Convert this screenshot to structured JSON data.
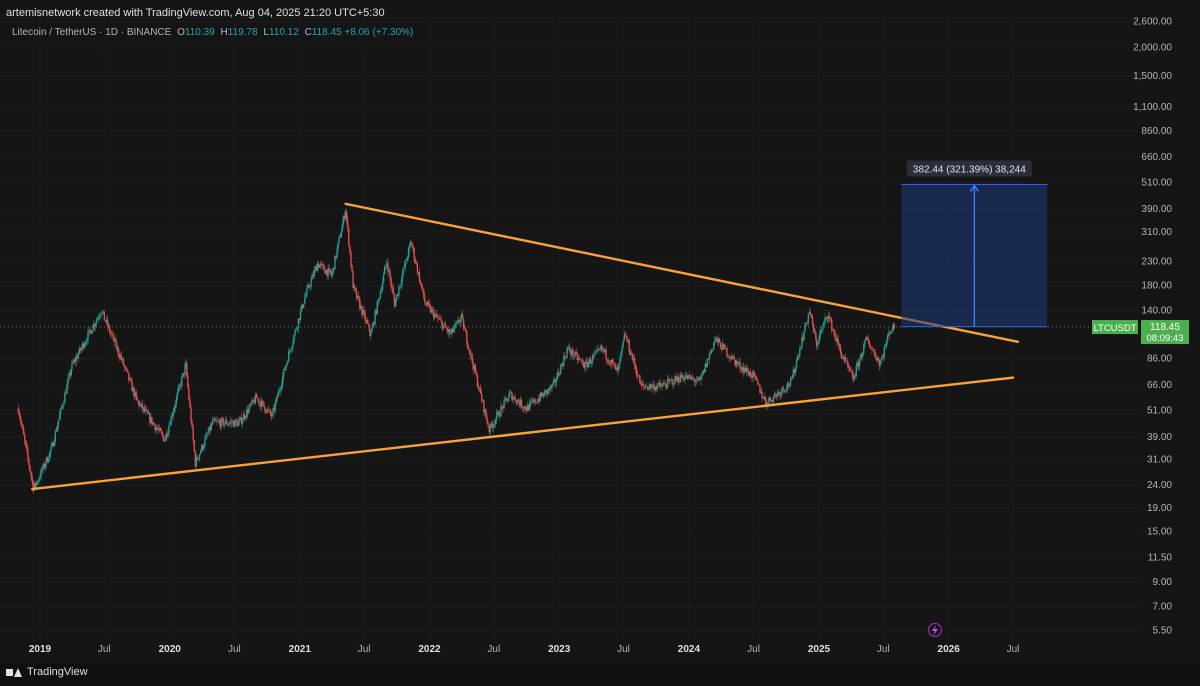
{
  "header": {
    "created_by": "artemisnetwork created with TradingView.com, Aug 04, 2025 21:20 UTC+5:30"
  },
  "symbol": {
    "name": "Litecoin / TetherUS · 1D · BINANCE",
    "o_label": "O",
    "o_value": "110.39",
    "h_label": "H",
    "h_value": "119.78",
    "l_label": "L",
    "l_value": "110.12",
    "c_label": "C",
    "c_value": "118.45",
    "change": "+8.06 (+7.30%)"
  },
  "brand": {
    "name": "TradingView"
  },
  "colors": {
    "background": "#131313",
    "trendline": "#f7a33a",
    "up": "#26a69a",
    "down": "#ef5350",
    "projection": "#2962ff",
    "price_tag": "#4caf50"
  },
  "chart_data": {
    "type": "candlestick",
    "y_scale": "log",
    "y_ticks": [
      "2,600.00",
      "2,000.00",
      "1,500.00",
      "1,100.00",
      "860.00",
      "660.00",
      "510.00",
      "390.00",
      "310.00",
      "230.00",
      "180.00",
      "140.00",
      "86.00",
      "66.00",
      "51.00",
      "39.00",
      "31.00",
      "24.00",
      "19.00",
      "15.00",
      "11.50",
      "9.00",
      "7.00",
      "5.50"
    ],
    "x_ticks": [
      "2019",
      "Jul",
      "2020",
      "Jul",
      "2021",
      "Jul",
      "2022",
      "Jul",
      "2023",
      "Jul",
      "2024",
      "Jul",
      "2025",
      "Jul",
      "2026",
      "Jul"
    ],
    "x_range": [
      "2019-01-01",
      "2026-09-15"
    ],
    "y_range": [
      5.2,
      2700
    ],
    "price_series": [
      [
        "2018-11-01",
        52
      ],
      [
        "2018-12-14",
        23
      ],
      [
        "2019-02-01",
        34
      ],
      [
        "2019-04-01",
        80
      ],
      [
        "2019-06-22",
        140
      ],
      [
        "2019-08-15",
        88
      ],
      [
        "2019-10-01",
        56
      ],
      [
        "2019-12-18",
        38
      ],
      [
        "2020-02-15",
        80
      ],
      [
        "2020-03-13",
        30
      ],
      [
        "2020-05-01",
        45
      ],
      [
        "2020-07-15",
        45
      ],
      [
        "2020-09-01",
        58
      ],
      [
        "2020-10-15",
        48
      ],
      [
        "2020-12-01",
        90
      ],
      [
        "2021-01-15",
        160
      ],
      [
        "2021-02-20",
        225
      ],
      [
        "2021-04-01",
        200
      ],
      [
        "2021-05-10",
        390
      ],
      [
        "2021-06-01",
        175
      ],
      [
        "2021-07-20",
        110
      ],
      [
        "2021-09-03",
        230
      ],
      [
        "2021-09-25",
        150
      ],
      [
        "2021-11-10",
        280
      ],
      [
        "2021-12-20",
        150
      ],
      [
        "2022-03-01",
        110
      ],
      [
        "2022-04-01",
        130
      ],
      [
        "2022-06-18",
        42
      ],
      [
        "2022-08-15",
        60
      ],
      [
        "2022-10-01",
        52
      ],
      [
        "2022-12-15",
        65
      ],
      [
        "2023-01-25",
        95
      ],
      [
        "2023-03-15",
        80
      ],
      [
        "2023-05-01",
        95
      ],
      [
        "2023-06-15",
        75
      ],
      [
        "2023-07-05",
        110
      ],
      [
        "2023-08-20",
        65
      ],
      [
        "2023-10-15",
        65
      ],
      [
        "2023-12-15",
        72
      ],
      [
        "2024-02-01",
        68
      ],
      [
        "2024-03-15",
        105
      ],
      [
        "2024-05-15",
        82
      ],
      [
        "2024-07-01",
        72
      ],
      [
        "2024-08-05",
        55
      ],
      [
        "2024-10-15",
        68
      ],
      [
        "2024-12-05",
        140
      ],
      [
        "2024-12-25",
        100
      ],
      [
        "2025-01-25",
        135
      ],
      [
        "2025-03-05",
        90
      ],
      [
        "2025-04-07",
        70
      ],
      [
        "2025-05-15",
        105
      ],
      [
        "2025-06-22",
        82
      ],
      [
        "2025-07-20",
        115
      ],
      [
        "2025-08-04",
        118.45
      ]
    ],
    "upper_trendline": [
      [
        "2021-05-10",
        412
      ],
      [
        "2026-07-15",
        102
      ]
    ],
    "lower_trendline": [
      [
        "2018-12-10",
        23
      ],
      [
        "2026-07-01",
        71
      ]
    ],
    "projection": {
      "label": "382.44 (321.39%) 38,244",
      "x_start": "2025-08-04",
      "x_end": "2026-06-15",
      "y_from": 119,
      "y_to": 501
    },
    "last_price": {
      "symbol": "LTCUSDT",
      "price": "118.45",
      "countdown": "08:09:43",
      "value": 118.45
    }
  }
}
